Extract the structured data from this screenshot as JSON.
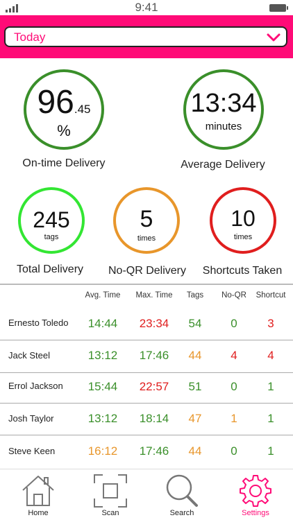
{
  "status": {
    "time": "9:41"
  },
  "period": {
    "selected": "Today"
  },
  "metrics": {
    "on_time": {
      "value_main": "96",
      "value_frac": ".45",
      "unit": "%",
      "label": "On-time Delivery"
    },
    "average": {
      "value": "13:34",
      "unit": "minutes",
      "label": "Average Delivery"
    },
    "total": {
      "value": "245",
      "unit": "tags",
      "label": "Total Delivery"
    },
    "no_qr": {
      "value": "5",
      "unit": "times",
      "label": "No-QR Delivery"
    },
    "shortcuts": {
      "value": "10",
      "unit": "times",
      "label": "Shortcuts Taken"
    }
  },
  "colors": {
    "accent": "#ff0b77",
    "green": "#3a8f2a",
    "bright_green": "#33e633",
    "orange": "#e8962b",
    "red": "#e01e1e"
  },
  "table": {
    "headers": [
      "Avg. Time",
      "Max. Time",
      "Tags",
      "No-QR",
      "Shortcut"
    ],
    "rows": [
      {
        "name": "Ernesto Toledo",
        "avg": "14:44",
        "max": "23:34",
        "tags": "54",
        "noqr": "0",
        "shortcut": "3"
      },
      {
        "name": "Jack Steel",
        "avg": "13:12",
        "max": "17:46",
        "tags": "44",
        "noqr": "4",
        "shortcut": "4"
      },
      {
        "name": "Errol Jackson",
        "avg": "15:44",
        "max": "22:57",
        "tags": "51",
        "noqr": "0",
        "shortcut": "1"
      },
      {
        "name": "Josh Taylor",
        "avg": "13:12",
        "max": "18:14",
        "tags": "47",
        "noqr": "1",
        "shortcut": "1"
      },
      {
        "name": "Steve Keen",
        "avg": "16:12",
        "max": "17:46",
        "tags": "44",
        "noqr": "0",
        "shortcut": "1"
      }
    ]
  },
  "tabs": [
    {
      "label": "Home",
      "icon": "home-icon"
    },
    {
      "label": "Scan",
      "icon": "scan-icon"
    },
    {
      "label": "Search",
      "icon": "search-icon"
    },
    {
      "label": "Settings",
      "icon": "gear-icon"
    }
  ]
}
